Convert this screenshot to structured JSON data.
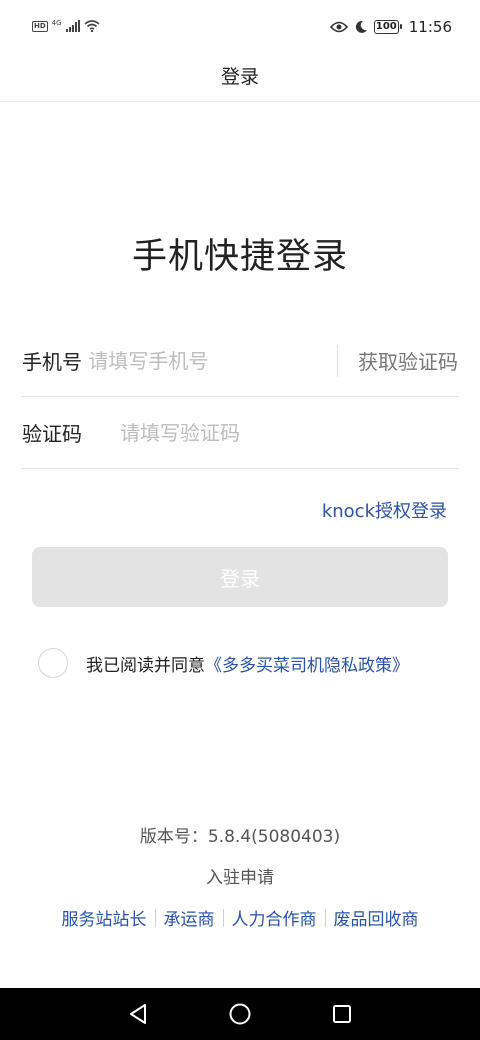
{
  "status_bar": {
    "hd_badge": "HD",
    "network_type": "4G",
    "icons": [
      "hd-icon",
      "signal-icon",
      "wifi-icon",
      "eye-icon",
      "moon-icon",
      "battery-icon"
    ],
    "battery_level": "100",
    "time": "11:56"
  },
  "nav": {
    "title": "登录"
  },
  "login": {
    "title": "手机快捷登录",
    "phone": {
      "label": "手机号",
      "placeholder": "请填写手机号",
      "value": ""
    },
    "code": {
      "label": "验证码",
      "placeholder": "请填写验证码",
      "value": "",
      "get_code_label": "获取验证码"
    },
    "knock_login": "knock授权登录",
    "submit_label": "登录",
    "agreement": {
      "text": "我已阅读并同意",
      "link": "《多多买菜司机隐私政策》",
      "checked": false
    }
  },
  "footer": {
    "version": "版本号：5.8.4(5080403)",
    "apply": "入驻申请",
    "roles": [
      "服务站站长",
      "承运商",
      "人力合作商",
      "废品回收商"
    ]
  },
  "theme": {
    "link_color": "#2a52a8",
    "button_disabled": "#e3e3e3"
  }
}
